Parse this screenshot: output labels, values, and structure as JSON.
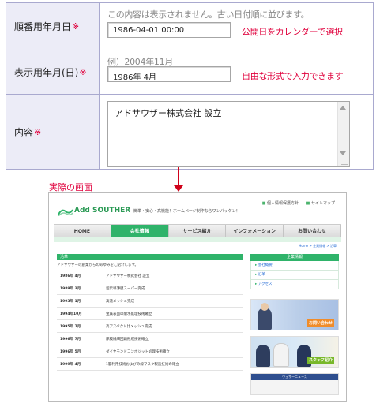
{
  "form": {
    "rows": [
      {
        "label": "順番用年月日",
        "required_mark": "※",
        "note": "この内容は表示されません。古い日付順に並びます。",
        "input_value": "1986-04-01 00:00",
        "hint": "公開日をカレンダーで選択"
      },
      {
        "label": "表示用年月(日)",
        "required_mark": "※",
        "note": "例）2004年11月",
        "input_value": "1986年 4月",
        "hint": "自由な形式で入力できます"
      },
      {
        "label": "内容",
        "required_mark": "※",
        "textarea_value": "アドサウザー株式会社 設立"
      }
    ]
  },
  "caption": "実際の画面",
  "preview": {
    "logo": "Add SOUTHER",
    "tagline": "簡単・安心・高機能！ホームページ制作ならワンパッケン！",
    "top_links": [
      "個人情報保護方針",
      "サイトマップ"
    ],
    "nav": [
      "HOME",
      "会社情報",
      "サービス紹介",
      "インフォメーション",
      "お問い合わせ"
    ],
    "breadcrumb": "Home > 企業情報 > 沿革",
    "section_title": "沿革",
    "intro": "アドサウザーの創業からのあゆみをご紹介します。",
    "history": [
      {
        "year": "1986年 4月",
        "text": "アドサウザー株式会社 設立"
      },
      {
        "year": "1989年 3月",
        "text": "超伝導薄膜スーパー完成"
      },
      {
        "year": "1993年 1月",
        "text": "高速メッシュ完成"
      },
      {
        "year": "1994年10月",
        "text": "金属表面の耐水処理技術確立"
      },
      {
        "year": "1995年 7月",
        "text": "高アスペクト比メッシュ完成"
      },
      {
        "year": "1996年 7月",
        "text": "厚膜繊細回路形成技術確立"
      },
      {
        "year": "1996年 5月",
        "text": "ダイヤモンドコンポジット処理技術確立"
      },
      {
        "year": "1999年 4月",
        "text": "1層利用技術およびの線マスク製造技術の確立"
      }
    ],
    "side": {
      "title": "企業情報",
      "items": [
        "会社概要",
        "沿革",
        "アクセス"
      ],
      "banner1_text": "お問い合わせ",
      "banner2_text": "スタッフ紹介",
      "banner3_text": "ウェザーニュース"
    }
  },
  "colors": {
    "accent": "#e0003c",
    "label_bg": "#ececf7",
    "brand_green": "#2fb36a"
  }
}
